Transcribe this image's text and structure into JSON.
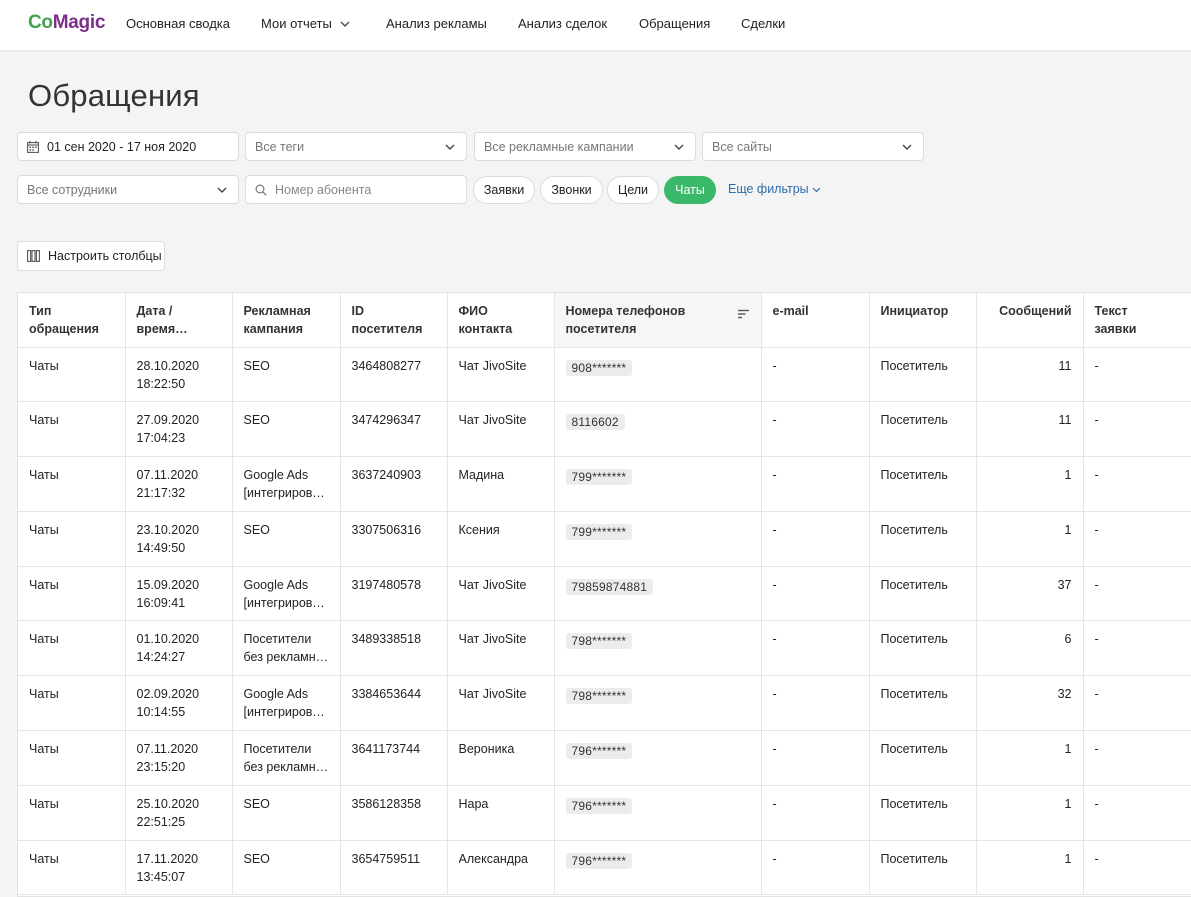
{
  "app": {
    "logo_part1": "Co",
    "logo_part2": "Magic"
  },
  "nav": {
    "items": [
      "Основная сводка",
      "Мои отчеты",
      "Анализ рекламы",
      "Анализ сделок",
      "Обращения",
      "Сделки"
    ]
  },
  "page": {
    "title": "Обращения"
  },
  "filters": {
    "date_range": "01 сен 2020 - 17 ноя 2020",
    "tags": "Все теги",
    "campaigns": "Все рекламные кампании",
    "sites": "Все сайты",
    "employees": "Все сотрудники",
    "phone_placeholder": "Номер абонента",
    "pills": [
      {
        "label": "Заявки",
        "active": false
      },
      {
        "label": "Звонки",
        "active": false
      },
      {
        "label": "Цели",
        "active": false
      },
      {
        "label": "Чаты",
        "active": true
      }
    ],
    "more_label": "Еще фильтры"
  },
  "toolbar": {
    "columns_label": "Настроить столбцы"
  },
  "table": {
    "headers": [
      [
        "Тип",
        "обращения"
      ],
      [
        "Дата /",
        "время…"
      ],
      [
        "Рекламная",
        "кампания"
      ],
      [
        "ID",
        "посетителя"
      ],
      [
        "ФИО",
        "контакта"
      ],
      [
        "Номера телефонов",
        "посетителя"
      ],
      [
        "e-mail",
        ""
      ],
      [
        "Инициатор",
        ""
      ],
      [
        "Сообщений",
        ""
      ],
      [
        "Текст",
        "заявки"
      ]
    ],
    "rows": [
      {
        "type": "Чаты",
        "date": "28.10.2020",
        "time": "18:22:50",
        "camp1": "SEO",
        "camp2": "",
        "id": "3464808277",
        "name": "Чат JivoSite",
        "phone": "908*******",
        "email": "-",
        "initiator": "Посетитель",
        "messages": "11",
        "text": "-"
      },
      {
        "type": "Чаты",
        "date": "27.09.2020",
        "time": "17:04:23",
        "camp1": "SEO",
        "camp2": "",
        "id": "3474296347",
        "name": "Чат JivoSite",
        "phone": "8116602",
        "email": "-",
        "initiator": "Посетитель",
        "messages": "11",
        "text": "-"
      },
      {
        "type": "Чаты",
        "date": "07.11.2020",
        "time": "21:17:32",
        "camp1": "Google Ads",
        "camp2": "[интегрирова…",
        "id": "3637240903",
        "name": "Мадина",
        "phone": "799*******",
        "email": "-",
        "initiator": "Посетитель",
        "messages": "1",
        "text": "-"
      },
      {
        "type": "Чаты",
        "date": "23.10.2020",
        "time": "14:49:50",
        "camp1": "SEO",
        "camp2": "",
        "id": "3307506316",
        "name": "Ксения",
        "phone": "799*******",
        "email": "-",
        "initiator": "Посетитель",
        "messages": "1",
        "text": "-"
      },
      {
        "type": "Чаты",
        "date": "15.09.2020",
        "time": "16:09:41",
        "camp1": "Google Ads",
        "camp2": "[интегрирова…",
        "id": "3197480578",
        "name": "Чат JivoSite",
        "phone": "79859874881",
        "email": "-",
        "initiator": "Посетитель",
        "messages": "37",
        "text": "-"
      },
      {
        "type": "Чаты",
        "date": "01.10.2020",
        "time": "14:24:27",
        "camp1": "Посетители",
        "camp2": "без рекламно…",
        "id": "3489338518",
        "name": "Чат JivoSite",
        "phone": "798*******",
        "email": "-",
        "initiator": "Посетитель",
        "messages": "6",
        "text": "-"
      },
      {
        "type": "Чаты",
        "date": "02.09.2020",
        "time": "10:14:55",
        "camp1": "Google Ads",
        "camp2": "[интегрирова…",
        "id": "3384653644",
        "name": "Чат JivoSite",
        "phone": "798*******",
        "email": "-",
        "initiator": "Посетитель",
        "messages": "32",
        "text": "-"
      },
      {
        "type": "Чаты",
        "date": "07.11.2020",
        "time": "23:15:20",
        "camp1": "Посетители",
        "camp2": "без рекламно…",
        "id": "3641173744",
        "name": "Вероника",
        "phone": "796*******",
        "email": "-",
        "initiator": "Посетитель",
        "messages": "1",
        "text": "-"
      },
      {
        "type": "Чаты",
        "date": "25.10.2020",
        "time": "22:51:25",
        "camp1": "SEO",
        "camp2": "",
        "id": "3586128358",
        "name": "Нара",
        "phone": "796*******",
        "email": "-",
        "initiator": "Посетитель",
        "messages": "1",
        "text": "-"
      },
      {
        "type": "Чаты",
        "date": "17.11.2020",
        "time": "13:45:07",
        "camp1": "SEO",
        "camp2": "",
        "id": "3654759511",
        "name": "Александра",
        "phone": "796*******",
        "email": "-",
        "initiator": "Посетитель",
        "messages": "1",
        "text": "-"
      }
    ]
  }
}
